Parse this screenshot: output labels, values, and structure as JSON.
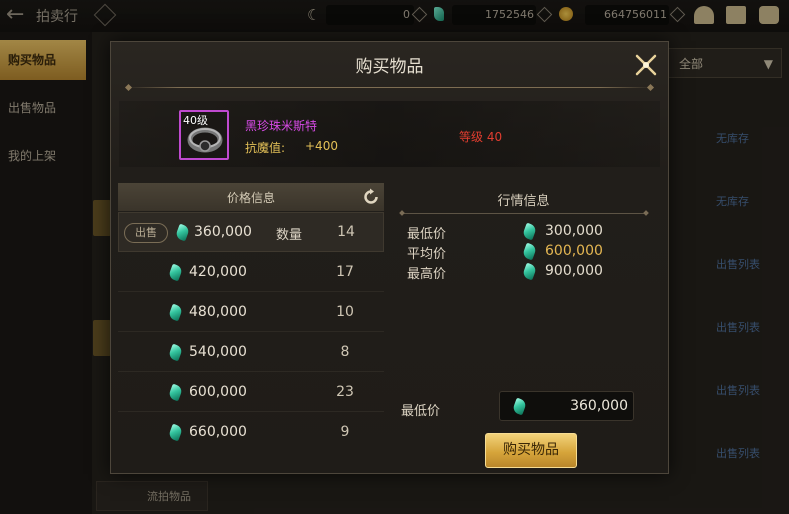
{
  "top_bar": {
    "title": "拍卖行",
    "currency_1": "0",
    "currency_2": "1752546",
    "currency_3": "664756011"
  },
  "left_nav": {
    "items": [
      {
        "label": "购买物品",
        "active": true
      },
      {
        "label": "出售物品",
        "active": false
      },
      {
        "label": "我的上架",
        "active": false
      }
    ]
  },
  "background": {
    "filter_label": "全部",
    "row_labels": [
      "无库存",
      "无库存",
      "出售列表",
      "出售列表",
      "出售列表",
      "出售列表"
    ],
    "bottom_button": "流拍物品"
  },
  "dialog": {
    "title": "购买物品",
    "item": {
      "level_tag": "40级",
      "name": "黑珍珠米斯特",
      "stat_label": "抗魔值:",
      "stat_value": "+400",
      "requirement": "等级 40",
      "name_color": "#d64ae6"
    },
    "price_info": {
      "title": "价格信息",
      "sell_tag": "出售",
      "qty_label": "数量",
      "rows": [
        {
          "price": "360,000",
          "qty": "14"
        },
        {
          "price": "420,000",
          "qty": "17"
        },
        {
          "price": "480,000",
          "qty": "10"
        },
        {
          "price": "540,000",
          "qty": "8"
        },
        {
          "price": "600,000",
          "qty": "23"
        },
        {
          "price": "660,000",
          "qty": "9"
        }
      ]
    },
    "market_info": {
      "title": "行情信息",
      "min_label": "最低价",
      "min_value": "300,000",
      "avg_label": "平均价",
      "avg_value": "600,000",
      "max_label": "最高价",
      "max_value": "900,000"
    },
    "purchase": {
      "lowest_label": "最低价",
      "lowest_value": "360,000",
      "buy_button": "购买物品"
    }
  }
}
